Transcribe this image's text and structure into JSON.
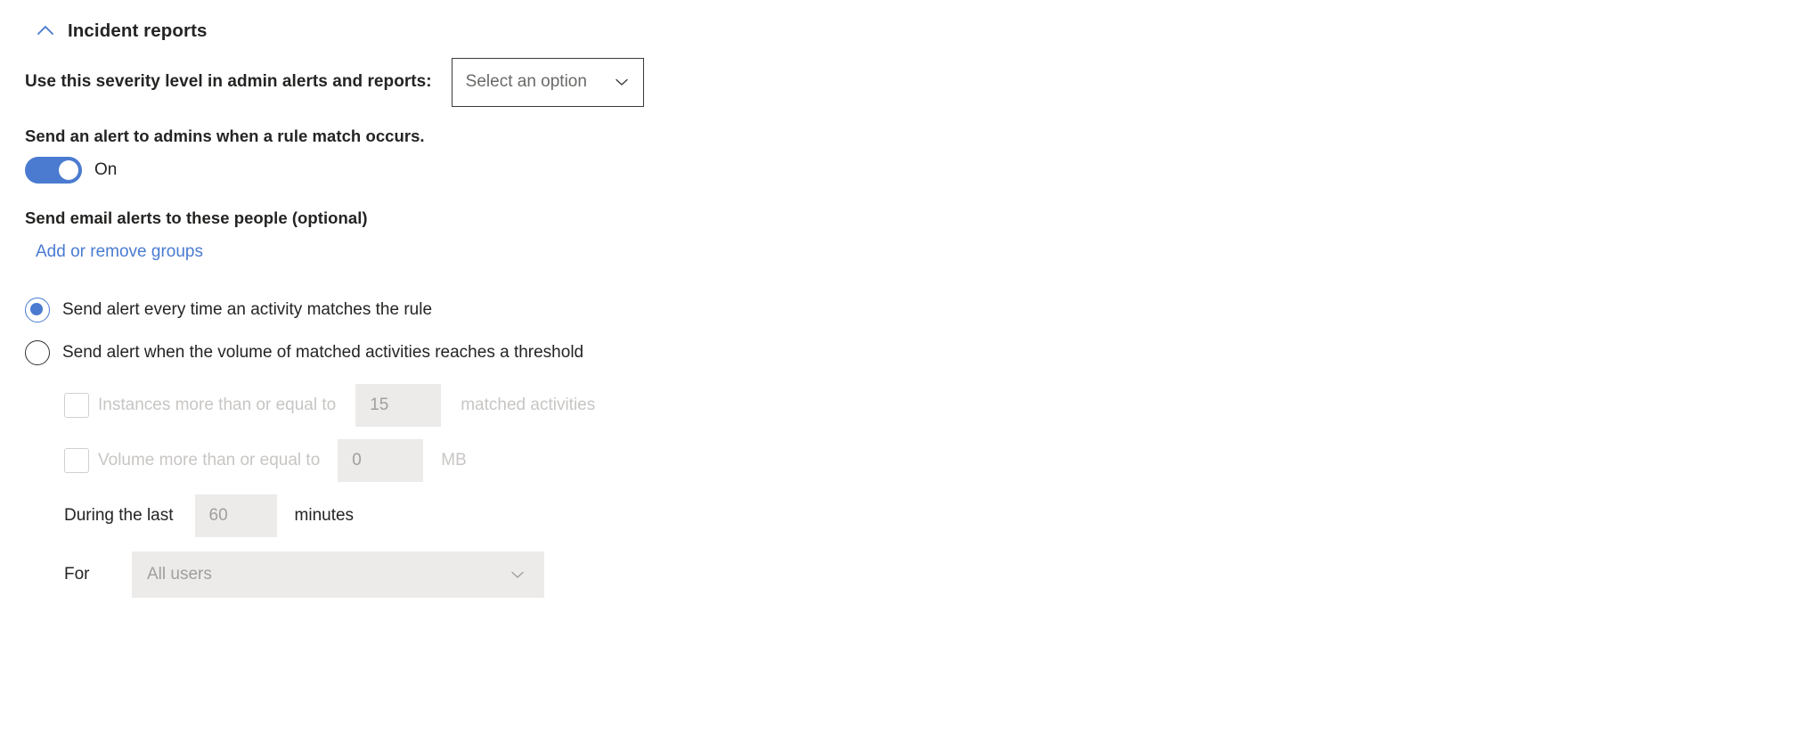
{
  "section": {
    "title": "Incident reports",
    "collapse_icon": "chevron-up-icon",
    "expanded": true
  },
  "severity": {
    "label": "Use this severity level in admin alerts and reports:",
    "dropdown_value": "Select an option",
    "dropdown_icon": "chevron-down-icon"
  },
  "admin_alert": {
    "description": "Send an alert to admins when a rule match occurs.",
    "toggle_state_label": "On",
    "toggle_on": true
  },
  "email_alerts": {
    "label": "Send email alerts to these people (optional)",
    "link_label": "Add or remove groups"
  },
  "alert_mode": {
    "options": [
      {
        "label": "Send alert every time an activity matches the rule",
        "selected": true
      },
      {
        "label": "Send alert when the volume of matched activities reaches a threshold",
        "selected": false
      }
    ]
  },
  "threshold": {
    "instances": {
      "checkbox_checked": false,
      "label": "Instances more than or equal to",
      "value": "15",
      "suffix": "matched activities"
    },
    "volume": {
      "checkbox_checked": false,
      "label": "Volume more than or equal to",
      "value": "0",
      "suffix": "MB"
    },
    "duration": {
      "prefix": "During the last",
      "value": "60",
      "suffix": "minutes"
    },
    "scope": {
      "label": "For",
      "value": "All users",
      "dropdown_icon": "chevron-down-icon"
    }
  },
  "colors": {
    "accent_blue": "#4a7bd0",
    "text_primary": "#252423",
    "text_disabled": "#c8c6c4",
    "field_disabled_bg": "#edebe9",
    "border_strong": "#3b3a39"
  }
}
